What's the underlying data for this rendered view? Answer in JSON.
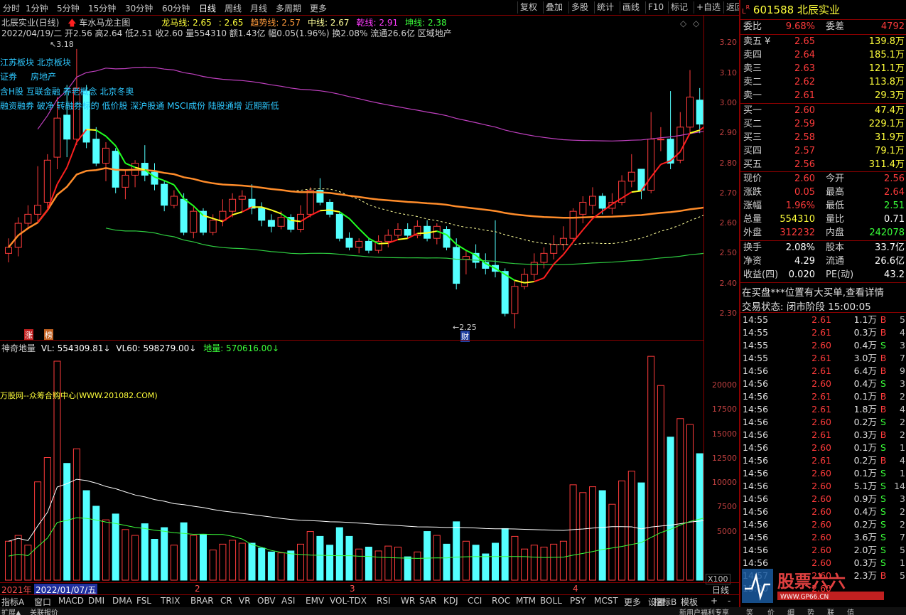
{
  "toolbar": {
    "periods": [
      "分时",
      "1分钟",
      "5分钟",
      "15分钟",
      "30分钟",
      "60分钟",
      "日线",
      "周线",
      "月线",
      "多周期",
      "更多"
    ],
    "active_period": "日线",
    "right_buttons": [
      "复权",
      "叠加",
      "多股",
      "统计",
      "画线",
      "F10",
      "标记",
      "+自选",
      "返回"
    ]
  },
  "chart_header": {
    "title": "北辰实业(日线)",
    "indicator_name": "车水马龙主图",
    "lines": [
      {
        "label": "龙马线: 2.65",
        "extra": ": 2.65",
        "color": "#ffff3b"
      },
      {
        "label": "趋势线: 2.57",
        "color": "#ff9a3b"
      },
      {
        "label": "中线: 2.67",
        "color": "#ffff9a"
      },
      {
        "label": "乾线: 2.91",
        "color": "#ff3bff"
      },
      {
        "label": "坤线: 2.38",
        "color": "#3bff3b"
      }
    ],
    "info": "2022/04/19/二 开2.56 高2.64 低2.51 收2.60 量554310 额1.43亿 幅0.05(1.96%) 换2.08% 流通26.6亿 区域地产",
    "high_mark": "3.18",
    "low_mark": "2.25",
    "tags_line1": "江苏板块 北京板块",
    "tags_line2": "证券     房地产",
    "tags_line3": "含H股 互联金融 养老概念 北京冬奥",
    "tags_line4": "融资融券 破净 转融券标的 低价股 深沪股通 MSCI成份 陆股通增 近期新低",
    "marker_zhang": "涨",
    "marker_bang": "榜",
    "marker_cai": "财"
  },
  "y_axis_price": [
    "3.20",
    "3.10",
    "3.00",
    "2.90",
    "2.80",
    "2.70",
    "2.60",
    "2.50",
    "2.40",
    "2.30"
  ],
  "y_axis_volume": [
    "20000",
    "17500",
    "15000",
    "12500",
    "10000",
    "7500",
    "5000"
  ],
  "volume_unit": "X100",
  "volume_header": {
    "name": "神奇地量",
    "vl": "VL: 554309.81",
    "vl60": "VL60: 598279.00",
    "diliang": "地量: 570616.00"
  },
  "watermark_text": "万股网--众筹合购中心(WWW.201082.COM)",
  "date_bar": {
    "year": "2021年",
    "date": "2022/01/07/五",
    "m2": "2",
    "m3": "3",
    "m4": "4",
    "period": "日线"
  },
  "indicator_tabs": [
    "指标A",
    "窗口",
    "MACD",
    "DMI",
    "DMA",
    "FSL",
    "TRIX",
    "BRAR",
    "CR",
    "VR",
    "OBV",
    "ASI",
    "EMV",
    "VOL-TDX",
    "RSI",
    "WR",
    "SAR",
    "KDJ",
    "CCI",
    "ROC",
    "MTM",
    "BOLL",
    "PSY",
    "MCST",
    "更多",
    "设置"
  ],
  "tab_right": [
    "指标B",
    "模板"
  ],
  "bottom_left": [
    "扩展▲",
    "关联报价"
  ],
  "bottom_right": [
    "新用户福利专享",
    "笑",
    "价",
    "细",
    "势",
    "联",
    "值"
  ],
  "panel": {
    "code": "601588",
    "name": "北辰实业",
    "webi_label": "委比",
    "webi": "9.68%",
    "weicha_label": "委差",
    "weicha": "4792",
    "asks": [
      {
        "label": "卖五 ¥",
        "price": "2.65",
        "vol": "139.8万"
      },
      {
        "label": "卖四",
        "price": "2.64",
        "vol": "185.1万"
      },
      {
        "label": "卖三",
        "price": "2.63",
        "vol": "121.1万"
      },
      {
        "label": "卖二",
        "price": "2.62",
        "vol": "113.8万"
      },
      {
        "label": "卖一",
        "price": "2.61",
        "vol": "29.3万"
      }
    ],
    "bids": [
      {
        "label": "买一",
        "price": "2.60",
        "vol": "47.4万"
      },
      {
        "label": "买二",
        "price": "2.59",
        "vol": "229.1万"
      },
      {
        "label": "买三",
        "price": "2.58",
        "vol": "31.9万"
      },
      {
        "label": "买四",
        "price": "2.57",
        "vol": "79.1万"
      },
      {
        "label": "买五",
        "price": "2.56",
        "vol": "311.4万"
      }
    ],
    "stats": [
      {
        "l1": "现价",
        "v1": "2.60",
        "c1": "red",
        "l2": "今开",
        "v2": "2.56",
        "c2": "red"
      },
      {
        "l1": "涨跌",
        "v1": "0.05",
        "c1": "red",
        "l2": "最高",
        "v2": "2.64",
        "c2": "red"
      },
      {
        "l1": "涨幅",
        "v1": "1.96%",
        "c1": "red",
        "l2": "最低",
        "v2": "2.51",
        "c2": "green"
      },
      {
        "l1": "总量",
        "v1": "554310",
        "c1": "yellow",
        "l2": "量比",
        "v2": "0.71",
        "c2": "white"
      },
      {
        "l1": "外盘",
        "v1": "312232",
        "c1": "red",
        "l2": "内盘",
        "v2": "242078",
        "c2": "green"
      }
    ],
    "stats2": [
      {
        "l1": "换手",
        "v1": "2.08%",
        "l2": "股本",
        "v2": "33.7亿"
      },
      {
        "l1": "净资",
        "v1": "4.29",
        "l2": "流通",
        "v2": "26.6亿"
      },
      {
        "l1": "收益(四)",
        "v1": "0.020",
        "l2": "PE(动)",
        "v2": "43.2"
      }
    ],
    "notice": "在买盘***位置有大买单,查看详情",
    "trade_status": "交易状态: 闭市阶段 15:00:05",
    "ticks": [
      {
        "t": "14:55",
        "p": "2.61",
        "q": "1.1万",
        "s": "B",
        "n": "5"
      },
      {
        "t": "14:55",
        "p": "2.61",
        "q": "0.3万",
        "s": "B",
        "n": "4"
      },
      {
        "t": "14:55",
        "p": "2.60",
        "q": "0.4万",
        "s": "S",
        "n": "3"
      },
      {
        "t": "14:55",
        "p": "2.61",
        "q": "3.0万",
        "s": "B",
        "n": "7"
      },
      {
        "t": "14:56",
        "p": "2.61",
        "q": "6.4万",
        "s": "B",
        "n": "9"
      },
      {
        "t": "14:56",
        "p": "2.60",
        "q": "0.4万",
        "s": "S",
        "n": "3"
      },
      {
        "t": "14:56",
        "p": "2.61",
        "q": "0.1万",
        "s": "B",
        "n": "2"
      },
      {
        "t": "14:56",
        "p": "2.61",
        "q": "1.8万",
        "s": "B",
        "n": "4"
      },
      {
        "t": "14:56",
        "p": "2.60",
        "q": "0.2万",
        "s": "S",
        "n": "2"
      },
      {
        "t": "14:56",
        "p": "2.61",
        "q": "0.3万",
        "s": "B",
        "n": "2"
      },
      {
        "t": "14:56",
        "p": "2.60",
        "q": "0.1万",
        "s": "S",
        "n": "1"
      },
      {
        "t": "14:56",
        "p": "2.61",
        "q": "0.2万",
        "s": "B",
        "n": "4"
      },
      {
        "t": "14:56",
        "p": "2.60",
        "q": "0.1万",
        "s": "S",
        "n": "1"
      },
      {
        "t": "14:56",
        "p": "2.60",
        "q": "5.1万",
        "s": "S",
        "n": "14"
      },
      {
        "t": "14:56",
        "p": "2.60",
        "q": "0.9万",
        "s": "S",
        "n": "3"
      },
      {
        "t": "14:56",
        "p": "2.60",
        "q": "0.4万",
        "s": "S",
        "n": "2"
      },
      {
        "t": "14:56",
        "p": "2.60",
        "q": "0.2万",
        "s": "S",
        "n": "2"
      },
      {
        "t": "14:56",
        "p": "2.60",
        "q": "3.6万",
        "s": "S",
        "n": "7"
      },
      {
        "t": "14:56",
        "p": "2.60",
        "q": "2.0万",
        "s": "S",
        "n": "5"
      },
      {
        "t": "14:56",
        "p": "2.60",
        "q": "0.3万",
        "s": "S",
        "n": "1"
      },
      {
        "t": "14:57",
        "p": "2.60",
        "q": "2.3万",
        "s": "B",
        "n": "5"
      },
      {
        "t": "15:00",
        "p": "2.60",
        "q": "",
        "s": "",
        "n": ""
      }
    ]
  },
  "colors": {
    "up": "#ff3b3b",
    "down": "#54ffff",
    "border": "#8b0000",
    "ma_orange": "#ff8c2a",
    "ma_magenta": "#c040c0",
    "ma_green": "#2ecc40",
    "mid_dash": "#ffff9a"
  },
  "chart_data": {
    "type": "candlestick",
    "ylim": [
      2.25,
      3.22
    ],
    "vol_ylim": [
      0,
      22500
    ],
    "candles": [
      {
        "o": 2.5,
        "c": 2.52,
        "h": 2.55,
        "l": 2.47,
        "v": 4000
      },
      {
        "o": 2.52,
        "c": 2.6,
        "h": 2.62,
        "l": 2.49,
        "v": 4600
      },
      {
        "o": 2.6,
        "c": 2.63,
        "h": 2.66,
        "l": 2.58,
        "v": 3600
      },
      {
        "o": 2.63,
        "c": 2.66,
        "h": 2.79,
        "l": 2.6,
        "v": 10100
      },
      {
        "o": 2.67,
        "c": 2.81,
        "h": 2.83,
        "l": 2.65,
        "v": 12600
      },
      {
        "o": 2.82,
        "c": 2.95,
        "h": 3.02,
        "l": 2.78,
        "v": 22500
      },
      {
        "o": 2.96,
        "c": 2.88,
        "h": 3.06,
        "l": 2.82,
        "v": 12000
      },
      {
        "o": 2.88,
        "c": 3.05,
        "h": 3.18,
        "l": 2.86,
        "v": 13500
      },
      {
        "o": 3.04,
        "c": 2.87,
        "h": 3.06,
        "l": 2.85,
        "v": 9200
      },
      {
        "o": 2.88,
        "c": 2.8,
        "h": 2.92,
        "l": 2.79,
        "v": 7600
      },
      {
        "o": 2.8,
        "c": 2.85,
        "h": 2.87,
        "l": 2.74,
        "v": 6200
      },
      {
        "o": 2.84,
        "c": 2.72,
        "h": 2.85,
        "l": 2.7,
        "v": 6800
      },
      {
        "o": 2.72,
        "c": 2.76,
        "h": 2.78,
        "l": 2.68,
        "v": 5200
      },
      {
        "o": 2.76,
        "c": 2.8,
        "h": 2.81,
        "l": 2.72,
        "v": 4600
      },
      {
        "o": 2.8,
        "c": 2.76,
        "h": 2.86,
        "l": 2.74,
        "v": 5800
      },
      {
        "o": 2.77,
        "c": 2.73,
        "h": 2.8,
        "l": 2.71,
        "v": 4200
      },
      {
        "o": 2.73,
        "c": 2.66,
        "h": 2.74,
        "l": 2.64,
        "v": 5400
      },
      {
        "o": 2.66,
        "c": 2.69,
        "h": 2.71,
        "l": 2.65,
        "v": 3600
      },
      {
        "o": 2.68,
        "c": 2.57,
        "h": 2.7,
        "l": 2.56,
        "v": 5900
      },
      {
        "o": 2.57,
        "c": 2.64,
        "h": 2.66,
        "l": 2.55,
        "v": 4600
      },
      {
        "o": 2.64,
        "c": 2.57,
        "h": 2.65,
        "l": 2.56,
        "v": 4700
      },
      {
        "o": 2.57,
        "c": 2.61,
        "h": 2.63,
        "l": 2.56,
        "v": 3100
      },
      {
        "o": 2.61,
        "c": 2.64,
        "h": 2.68,
        "l": 2.59,
        "v": 3700
      },
      {
        "o": 2.64,
        "c": 2.68,
        "h": 2.7,
        "l": 2.62,
        "v": 4100
      },
      {
        "o": 2.68,
        "c": 2.69,
        "h": 2.71,
        "l": 2.64,
        "v": 3800
      },
      {
        "o": 2.68,
        "c": 2.65,
        "h": 2.73,
        "l": 2.63,
        "v": 3800
      },
      {
        "o": 2.65,
        "c": 2.61,
        "h": 2.67,
        "l": 2.59,
        "v": 3300
      },
      {
        "o": 2.61,
        "c": 2.59,
        "h": 2.63,
        "l": 2.57,
        "v": 2900
      },
      {
        "o": 2.59,
        "c": 2.62,
        "h": 2.64,
        "l": 2.58,
        "v": 2800
      },
      {
        "o": 2.62,
        "c": 2.58,
        "h": 2.63,
        "l": 2.57,
        "v": 3000
      },
      {
        "o": 2.58,
        "c": 2.63,
        "h": 2.66,
        "l": 2.57,
        "v": 3700
      },
      {
        "o": 2.63,
        "c": 2.71,
        "h": 2.72,
        "l": 2.62,
        "v": 5000
      },
      {
        "o": 2.71,
        "c": 2.67,
        "h": 2.75,
        "l": 2.66,
        "v": 4500
      },
      {
        "o": 2.67,
        "c": 2.63,
        "h": 2.68,
        "l": 2.62,
        "v": 3600
      },
      {
        "o": 2.63,
        "c": 2.55,
        "h": 2.64,
        "l": 2.54,
        "v": 5400
      },
      {
        "o": 2.55,
        "c": 2.52,
        "h": 2.57,
        "l": 2.51,
        "v": 4500
      },
      {
        "o": 2.52,
        "c": 2.54,
        "h": 2.55,
        "l": 2.5,
        "v": 3200
      },
      {
        "o": 2.54,
        "c": 2.51,
        "h": 2.55,
        "l": 2.5,
        "v": 3400
      },
      {
        "o": 2.51,
        "c": 2.54,
        "h": 2.56,
        "l": 2.5,
        "v": 3000
      },
      {
        "o": 2.54,
        "c": 2.56,
        "h": 2.58,
        "l": 2.52,
        "v": 3500
      },
      {
        "o": 2.56,
        "c": 2.58,
        "h": 2.6,
        "l": 2.55,
        "v": 3400
      },
      {
        "o": 2.58,
        "c": 2.56,
        "h": 2.6,
        "l": 2.55,
        "v": 2400
      },
      {
        "o": 2.56,
        "c": 2.59,
        "h": 2.61,
        "l": 2.55,
        "v": 2900
      },
      {
        "o": 2.59,
        "c": 2.55,
        "h": 2.61,
        "l": 2.54,
        "v": 5000
      },
      {
        "o": 2.55,
        "c": 2.59,
        "h": 2.6,
        "l": 2.53,
        "v": 4600
      },
      {
        "o": 2.58,
        "c": 2.52,
        "h": 2.59,
        "l": 2.51,
        "v": 3700
      },
      {
        "o": 2.52,
        "c": 2.4,
        "h": 2.55,
        "l": 2.38,
        "v": 6000
      },
      {
        "o": 2.48,
        "c": 2.49,
        "h": 2.51,
        "l": 2.43,
        "v": 4000
      },
      {
        "o": 2.5,
        "c": 2.47,
        "h": 2.53,
        "l": 2.45,
        "v": 3600
      },
      {
        "o": 2.47,
        "c": 2.45,
        "h": 2.5,
        "l": 2.43,
        "v": 2700
      },
      {
        "o": 2.46,
        "c": 2.44,
        "h": 2.61,
        "l": 2.42,
        "v": 3800
      },
      {
        "o": 2.44,
        "c": 2.3,
        "h": 2.45,
        "l": 2.29,
        "v": 5300
      },
      {
        "o": 2.3,
        "c": 2.39,
        "h": 2.41,
        "l": 2.25,
        "v": 4500
      },
      {
        "o": 2.39,
        "c": 2.43,
        "h": 2.45,
        "l": 2.38,
        "v": 3200
      },
      {
        "o": 2.43,
        "c": 2.47,
        "h": 2.5,
        "l": 2.41,
        "v": 3600
      },
      {
        "o": 2.47,
        "c": 2.5,
        "h": 2.52,
        "l": 2.45,
        "v": 3400
      },
      {
        "o": 2.5,
        "c": 2.53,
        "h": 2.56,
        "l": 2.48,
        "v": 3700
      },
      {
        "o": 2.53,
        "c": 2.55,
        "h": 2.59,
        "l": 2.51,
        "v": 4000
      },
      {
        "o": 2.55,
        "c": 2.64,
        "h": 2.65,
        "l": 2.54,
        "v": 9800
      },
      {
        "o": 2.63,
        "c": 2.67,
        "h": 2.69,
        "l": 2.6,
        "v": 9000
      },
      {
        "o": 2.66,
        "c": 2.69,
        "h": 2.72,
        "l": 2.63,
        "v": 9600
      },
      {
        "o": 2.69,
        "c": 2.65,
        "h": 2.7,
        "l": 2.63,
        "v": 9200
      },
      {
        "o": 2.65,
        "c": 2.67,
        "h": 2.7,
        "l": 2.63,
        "v": 7800
      },
      {
        "o": 2.67,
        "c": 2.74,
        "h": 2.76,
        "l": 2.66,
        "v": 10200
      },
      {
        "o": 2.74,
        "c": 2.77,
        "h": 2.83,
        "l": 2.72,
        "v": 11200
      },
      {
        "o": 2.78,
        "c": 2.71,
        "h": 2.78,
        "l": 2.68,
        "v": 10000
      },
      {
        "o": 2.71,
        "c": 2.88,
        "h": 2.97,
        "l": 2.7,
        "v": 23000
      },
      {
        "o": 2.88,
        "c": 2.88,
        "h": 2.92,
        "l": 2.84,
        "v": 20000
      },
      {
        "o": 2.88,
        "c": 2.8,
        "h": 3.04,
        "l": 2.78,
        "v": 14700
      },
      {
        "o": 2.81,
        "c": 2.92,
        "h": 2.97,
        "l": 2.8,
        "v": 16600
      },
      {
        "o": 2.92,
        "c": 3.02,
        "h": 3.11,
        "l": 2.9,
        "v": 16000
      },
      {
        "o": 3.01,
        "c": 2.93,
        "h": 3.05,
        "l": 2.9,
        "v": 13000
      },
      {
        "o": 2.94,
        "c": 3.0,
        "h": 3.02,
        "l": 2.92,
        "v": 11400
      },
      {
        "o": 3.0,
        "c": 2.87,
        "h": 3.03,
        "l": 2.85,
        "v": 13500
      },
      {
        "o": 2.88,
        "c": 2.83,
        "h": 2.9,
        "l": 2.82,
        "v": 11200
      },
      {
        "o": 2.83,
        "c": 2.73,
        "h": 2.84,
        "l": 2.71,
        "v": 9000
      },
      {
        "o": 2.73,
        "c": 2.71,
        "h": 2.8,
        "l": 2.7,
        "v": 7800
      },
      {
        "o": 2.72,
        "c": 2.64,
        "h": 2.73,
        "l": 2.62,
        "v": 6800
      },
      {
        "o": 2.64,
        "c": 2.7,
        "h": 2.72,
        "l": 2.62,
        "v": 6700
      },
      {
        "o": 2.71,
        "c": 2.61,
        "h": 2.72,
        "l": 2.58,
        "v": 8600
      },
      {
        "o": 2.6,
        "c": 2.58,
        "h": 2.62,
        "l": 2.56,
        "v": 5500
      },
      {
        "o": 2.56,
        "c": 2.6,
        "h": 2.64,
        "l": 2.51,
        "v": 5543
      }
    ]
  }
}
